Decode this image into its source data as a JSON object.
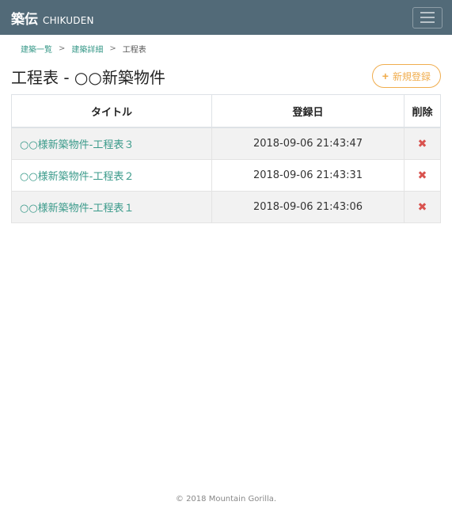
{
  "navbar": {
    "brand_jp": "築伝",
    "brand_en": "CHIKUDEN"
  },
  "breadcrumb": {
    "items": [
      "建築一覧",
      "建築詳細",
      "工程表"
    ],
    "separator": ">"
  },
  "page": {
    "title": "工程表 - ○○新築物件",
    "new_button_label": "新規登録",
    "new_button_icon": "+"
  },
  "table": {
    "headers": {
      "title": "タイトル",
      "date": "登録日",
      "delete": "削除"
    },
    "rows": [
      {
        "title": "○○様新築物件-工程表３",
        "date": "2018-09-06 21:43:47",
        "delete_icon": "✖"
      },
      {
        "title": "○○様新築物件-工程表２",
        "date": "2018-09-06 21:43:31",
        "delete_icon": "✖"
      },
      {
        "title": "○○様新築物件-工程表１",
        "date": "2018-09-06 21:43:06",
        "delete_icon": "✖"
      }
    ]
  },
  "footer": {
    "text": "© 2018 Mountain Gorilla."
  },
  "colors": {
    "navbar": "#526a78",
    "link": "#3a9a8a",
    "accent": "#f0ad4e",
    "danger": "#d9534f"
  }
}
